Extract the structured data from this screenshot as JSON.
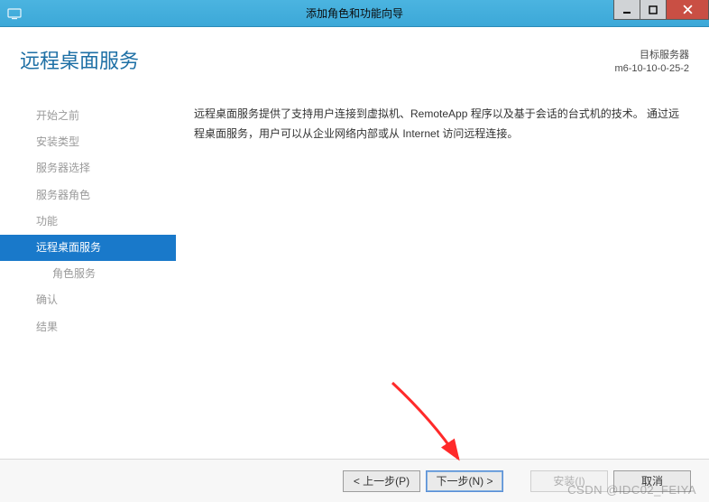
{
  "window": {
    "title": "添加角色和功能向导"
  },
  "header": {
    "page_title": "远程桌面服务",
    "target_label": "目标服务器",
    "target_name": "m6-10-10-0-25-2"
  },
  "sidebar": {
    "items": [
      {
        "label": "开始之前",
        "state": "dim"
      },
      {
        "label": "安装类型",
        "state": "dim"
      },
      {
        "label": "服务器选择",
        "state": "dim"
      },
      {
        "label": "服务器角色",
        "state": "dim"
      },
      {
        "label": "功能",
        "state": "dim"
      },
      {
        "label": "远程桌面服务",
        "state": "selected"
      },
      {
        "label": "角色服务",
        "state": "child"
      },
      {
        "label": "确认",
        "state": "dim"
      },
      {
        "label": "结果",
        "state": "dim"
      }
    ]
  },
  "body": {
    "text": "远程桌面服务提供了支持用户连接到虚拟机、RemoteApp 程序以及基于会话的台式机的技术。 通过远程桌面服务，用户可以从企业网络内部或从 Internet 访问远程连接。"
  },
  "buttons": {
    "prev": "< 上一步(P)",
    "next": "下一步(N) >",
    "install": "安装(I)",
    "cancel": "取消"
  },
  "watermark": "CSDN @IDC02_FEIYA"
}
